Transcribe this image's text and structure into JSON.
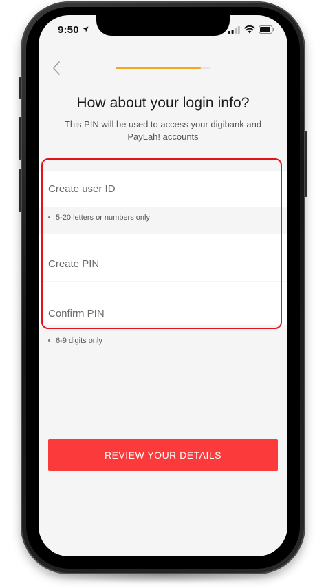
{
  "status_bar": {
    "time": "9:50"
  },
  "header": {
    "back_icon": "chevron-left-icon",
    "progress": 0.9
  },
  "page": {
    "title": "How about your login info?",
    "subtitle": "This PIN will be used to access your digibank and PayLah! accounts"
  },
  "form": {
    "user_id": {
      "placeholder": "Create user ID",
      "value": "",
      "hint": "5-20 letters or numbers only"
    },
    "create_pin": {
      "placeholder": "Create PIN",
      "value": ""
    },
    "confirm_pin": {
      "placeholder": "Confirm PIN",
      "value": ""
    },
    "pin_hint": "6-9 digits only"
  },
  "actions": {
    "review_label": "REVIEW YOUR DETAILS"
  },
  "colors": {
    "accent": "#fb3b3b",
    "progress": "#f5a623",
    "highlight": "#e3131b",
    "background": "#f5f5f5"
  }
}
